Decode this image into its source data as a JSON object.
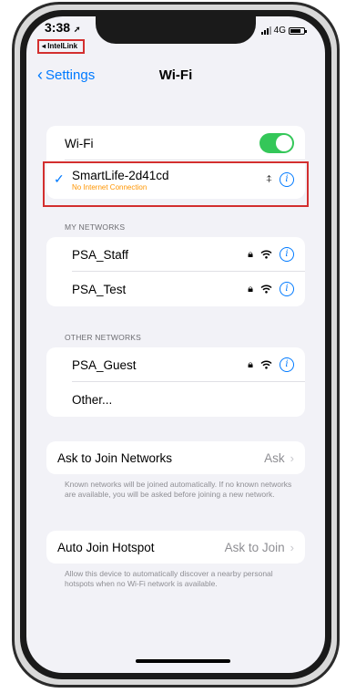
{
  "status_bar": {
    "time": "3:38",
    "network": "4G"
  },
  "back_app": {
    "label": "◂ IntelLink"
  },
  "nav": {
    "back_label": "Settings",
    "title": "Wi-Fi"
  },
  "wifi": {
    "label": "Wi-Fi",
    "enabled": true
  },
  "connected": {
    "name": "SmartLife-2d41cd",
    "status": "No Internet Connection"
  },
  "my_networks": {
    "header": "MY NETWORKS",
    "items": [
      {
        "name": "PSA_Staff",
        "locked": true
      },
      {
        "name": "PSA_Test",
        "locked": true
      }
    ]
  },
  "other_networks": {
    "header": "OTHER NETWORKS",
    "items": [
      {
        "name": "PSA_Guest",
        "locked": true
      },
      {
        "name": "Other..."
      }
    ]
  },
  "ask_to_join": {
    "label": "Ask to Join Networks",
    "value": "Ask",
    "footnote": "Known networks will be joined automatically. If no known networks are available, you will be asked before joining a new network."
  },
  "auto_join_hotspot": {
    "label": "Auto Join Hotspot",
    "value": "Ask to Join",
    "footnote": "Allow this device to automatically discover a nearby personal hotspots when no Wi-Fi network is available."
  },
  "colors": {
    "accent": "#007aff",
    "toggle_on": "#34c759",
    "warning": "#ff9500",
    "highlight_box": "#d32f2f"
  }
}
